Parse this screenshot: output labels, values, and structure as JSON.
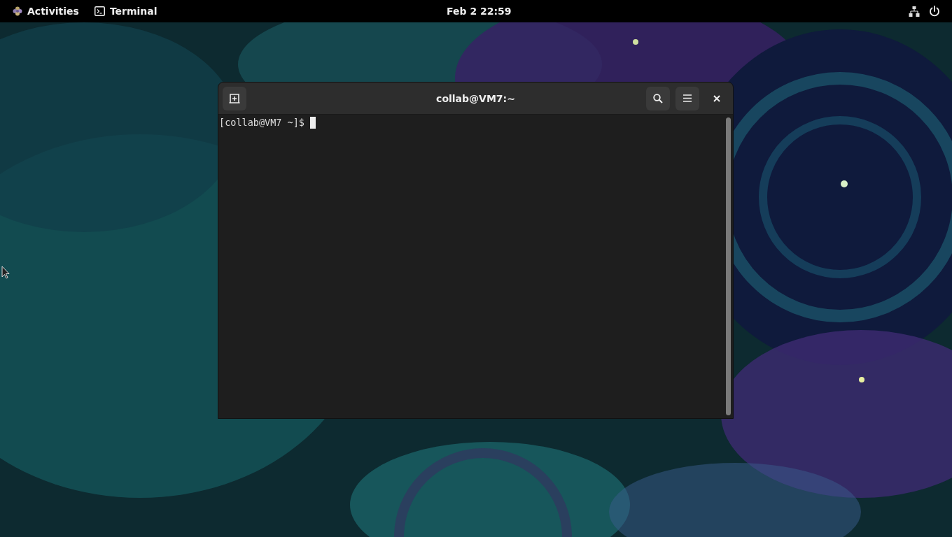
{
  "top_bar": {
    "activities": "Activities",
    "app_menu": "Terminal",
    "clock": "Feb 2  22:59"
  },
  "terminal_window": {
    "title": "collab@VM7:~",
    "prompt": "[collab@VM7 ~]$ "
  }
}
